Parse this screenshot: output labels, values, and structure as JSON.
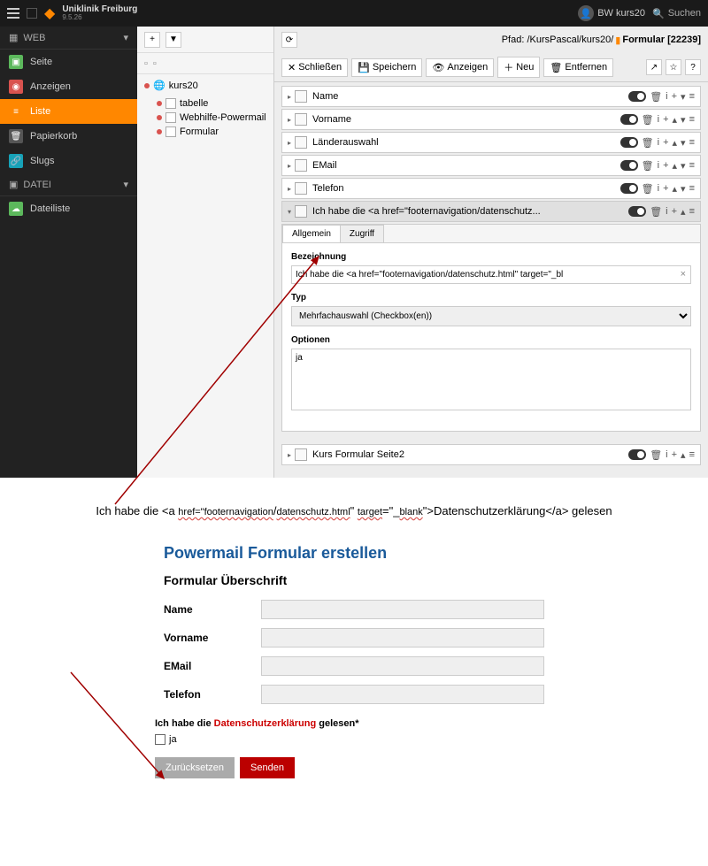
{
  "topbar": {
    "brand_title": "Uniklinik Freiburg",
    "brand_version": "9.5.26",
    "user_label": "BW kurs20",
    "search_placeholder": "Suchen"
  },
  "sidebar": {
    "section_web": "WEB",
    "items_web": [
      {
        "label": "Seite"
      },
      {
        "label": "Anzeigen"
      },
      {
        "label": "Liste"
      },
      {
        "label": "Papierkorb"
      },
      {
        "label": "Slugs"
      }
    ],
    "section_file": "DATEI",
    "items_file": [
      {
        "label": "Dateiliste"
      }
    ]
  },
  "tree": {
    "root": "kurs20",
    "children": [
      {
        "label": "tabelle"
      },
      {
        "label": "Webhilfe-Powermail"
      },
      {
        "label": "Formular"
      }
    ]
  },
  "path": {
    "prefix": "Pfad: /KursPascal/kurs20/",
    "current": "Formular [22239]"
  },
  "action_bar": {
    "close": "Schließen",
    "save": "Speichern",
    "view": "Anzeigen",
    "new": "Neu",
    "delete": "Entfernen"
  },
  "records": [
    {
      "label": "Name"
    },
    {
      "label": "Vorname"
    },
    {
      "label": "Länderauswahl"
    },
    {
      "label": "EMail"
    },
    {
      "label": "Telefon"
    }
  ],
  "expanded_record": {
    "header": "Ich habe die <a href=\"footernavigation/datenschutz...",
    "tab_general": "Allgemein",
    "tab_access": "Zugriff",
    "field_label_title": "Bezeichnung",
    "field_label_value": "Ich habe die <a href=\"footernavigation/datenschutz.html\" target=\"_bl",
    "field_type_title": "Typ",
    "field_type_value": "Mehrfachauswahl (Checkbox(en))",
    "field_options_title": "Optionen",
    "field_options_value": "ja"
  },
  "footer_record": {
    "label": "Kurs Formular Seite2"
  },
  "annotation": {
    "text_full": "Ich habe die <a href=\"footernavigation/datenschutz.html\" target=\"_blank\">Datenschutzerklärung</a> gelesen"
  },
  "frontend": {
    "title": "Powermail Formular erstellen",
    "subtitle": "Formular Überschrift",
    "fields": [
      {
        "label": "Name"
      },
      {
        "label": "Vorname"
      },
      {
        "label": "EMail"
      },
      {
        "label": "Telefon"
      }
    ],
    "checkbox_pre": "Ich habe die ",
    "checkbox_link": "Datenschutzerklärung",
    "checkbox_post": " gelesen*",
    "checkbox_option": "ja",
    "btn_reset": "Zurücksetzen",
    "btn_submit": "Senden"
  }
}
